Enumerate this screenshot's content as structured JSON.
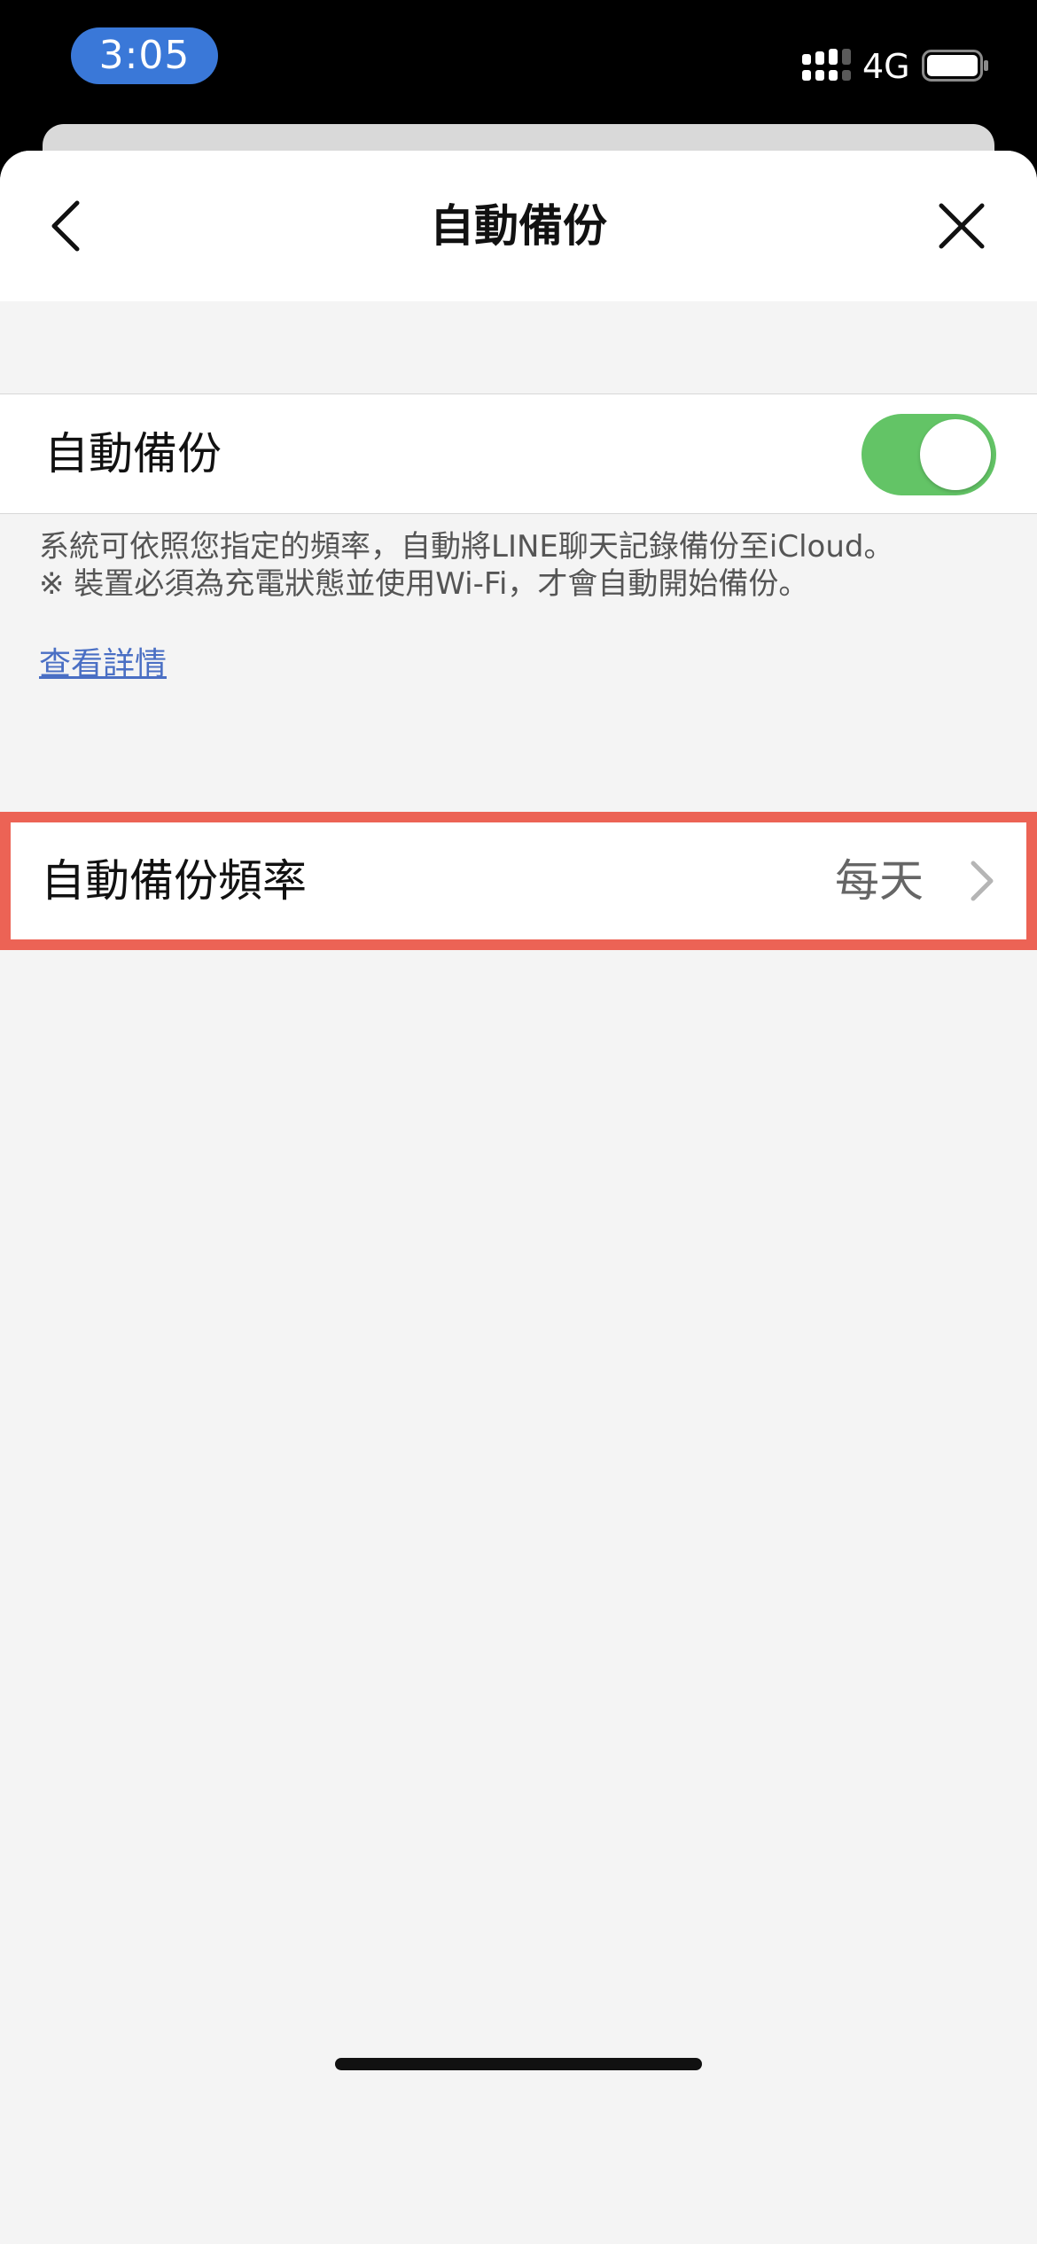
{
  "status_bar": {
    "time": "3:05",
    "network": "4G",
    "signal_icon": "cellular-signal-icon",
    "battery_icon": "battery-icon"
  },
  "nav": {
    "title": "自動備份",
    "back_icon": "chevron-left-icon",
    "close_icon": "close-icon"
  },
  "backup_toggle": {
    "label": "自動備份",
    "enabled": true,
    "on_color": "#63c466"
  },
  "description": {
    "line1": "系統可依照您指定的頻率，自動將LINE聊天記錄備份至iCloud。",
    "line2": "※ 裝置必須為充電狀態並使用Wi-Fi，才會自動開始備份。",
    "link": "查看詳情",
    "link_color": "#4a6fc4"
  },
  "frequency": {
    "label": "自動備份頻率",
    "value": "每天",
    "highlight_color": "#ec6355",
    "chevron_icon": "chevron-right-icon"
  }
}
